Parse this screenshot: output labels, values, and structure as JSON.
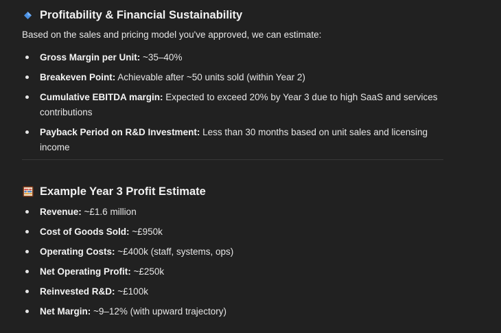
{
  "section1": {
    "icon": "blue-diamond-icon",
    "title": "Profitability & Financial Sustainability",
    "intro": "Based on the sales and pricing model you've approved, we can estimate:",
    "items": [
      {
        "label": "Gross Margin per Unit:",
        "text": " ~35–40%"
      },
      {
        "label": "Breakeven Point:",
        "text": " Achievable after ~50 units sold (within Year 2)"
      },
      {
        "label": "Cumulative EBITDA margin:",
        "text": " Expected to exceed 20% by Year 3 due to high SaaS and services contributions"
      },
      {
        "label": "Payback Period on R&D Investment:",
        "text": " Less than 30 months based on unit sales and licensing income"
      }
    ]
  },
  "section2": {
    "icon": "abacus-icon",
    "title": "Example Year 3 Profit Estimate",
    "items": [
      {
        "label": "Revenue:",
        "text": " ~£1.6 million"
      },
      {
        "label": "Cost of Goods Sold:",
        "text": " ~£950k"
      },
      {
        "label": "Operating Costs:",
        "text": " ~£400k (staff, systems, ops)"
      },
      {
        "label": "Net Operating Profit:",
        "text": " ~£250k"
      },
      {
        "label": "Reinvested R&D:",
        "text": " ~£100k"
      },
      {
        "label": "Net Margin:",
        "text": " ~9–12% (with upward trajectory)"
      }
    ]
  },
  "colors": {
    "background": "#212121",
    "text": "#ececec",
    "diamond": "#4a90e2"
  }
}
